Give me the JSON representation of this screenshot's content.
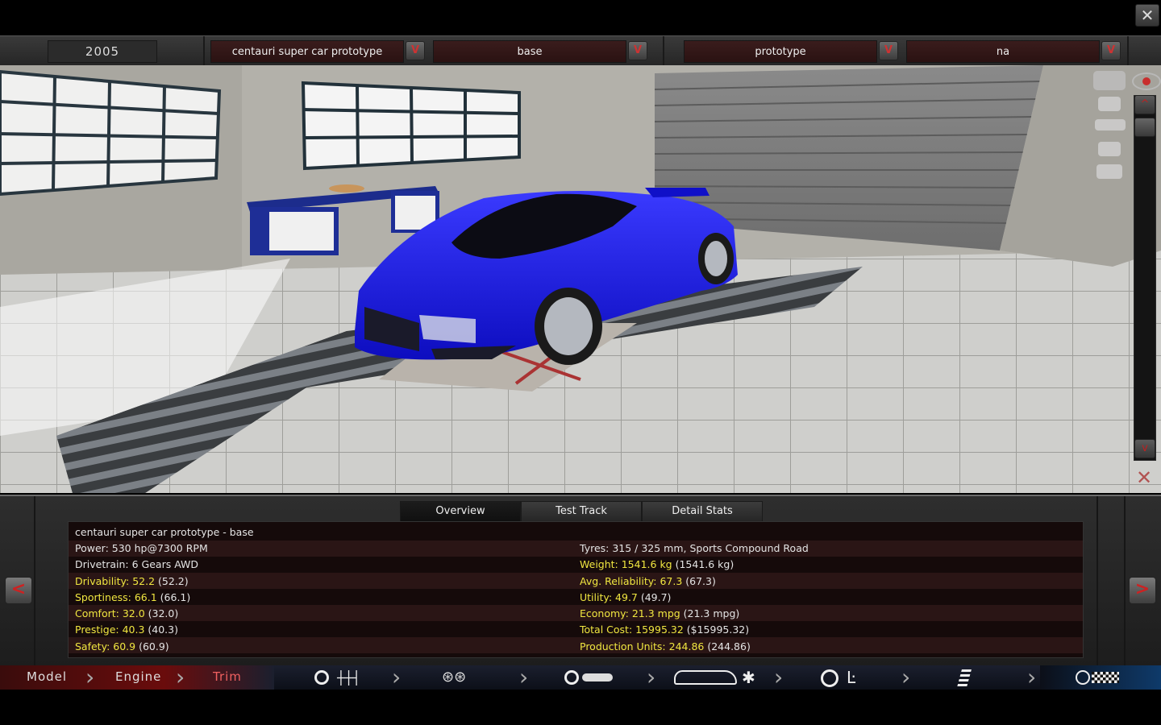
{
  "header": {
    "year": "2005",
    "model_select": "centauri super car prototype",
    "trim_select": "base",
    "type_select": "prototype",
    "variant_select": "na",
    "dropdown_glyph": "V",
    "close_glyph": "✕"
  },
  "scroll": {
    "up": "^",
    "down": "v"
  },
  "tabs": [
    "Overview",
    "Test Track",
    "Detail Stats"
  ],
  "overview": {
    "title": "centauri super car prototype - base",
    "left": [
      {
        "text": "Power: 530 hp@7300 RPM",
        "highlight": "",
        "rest": ""
      },
      {
        "text": "Drivetrain: 6 Gears AWD",
        "highlight": "",
        "rest": ""
      },
      {
        "text": "",
        "highlight": "Drivability: 52.2",
        "rest": " (52.2)"
      },
      {
        "text": "",
        "highlight": "Sportiness: 66.1",
        "rest": " (66.1)"
      },
      {
        "text": "",
        "highlight": "Comfort: 32.0",
        "rest": " (32.0)"
      },
      {
        "text": "",
        "highlight": "Prestige: 40.3",
        "rest": " (40.3)"
      },
      {
        "text": "",
        "highlight": "Safety: 60.9",
        "rest": " (60.9)"
      }
    ],
    "right": [
      {
        "text": "Tyres: 315 / 325 mm, Sports Compound Road",
        "highlight": "",
        "rest": ""
      },
      {
        "text": "",
        "highlight": "Weight: 1541.6 kg",
        "rest": " (1541.6 kg)"
      },
      {
        "text": "",
        "highlight": "Avg. Reliability: 67.3",
        "rest": " (67.3)"
      },
      {
        "text": "",
        "highlight": "Utility: 49.7",
        "rest": " (49.7)"
      },
      {
        "text": "",
        "highlight": "Economy: 21.3 mpg",
        "rest": " (21.3 mpg)"
      },
      {
        "text": "",
        "highlight": "Total Cost: 15995.32",
        "rest": " ($15995.32)"
      },
      {
        "text": "",
        "highlight": "Production Units: 244.86",
        "rest": " (244.86)"
      }
    ]
  },
  "nav_arrows": {
    "prev": "<",
    "next": ">"
  },
  "nav": {
    "model": "Model",
    "engine": "Engine",
    "trim": "Trim",
    "icons": [
      "gearbox-icon",
      "wheels-icon",
      "tyre-body-icon",
      "aero-icon",
      "interior-icon",
      "suspension-icon",
      "test-finish-icon"
    ]
  },
  "colors": {
    "car": "#1a1ae6",
    "accent_red": "#c22222",
    "stat_highlight": "#f0e640"
  }
}
